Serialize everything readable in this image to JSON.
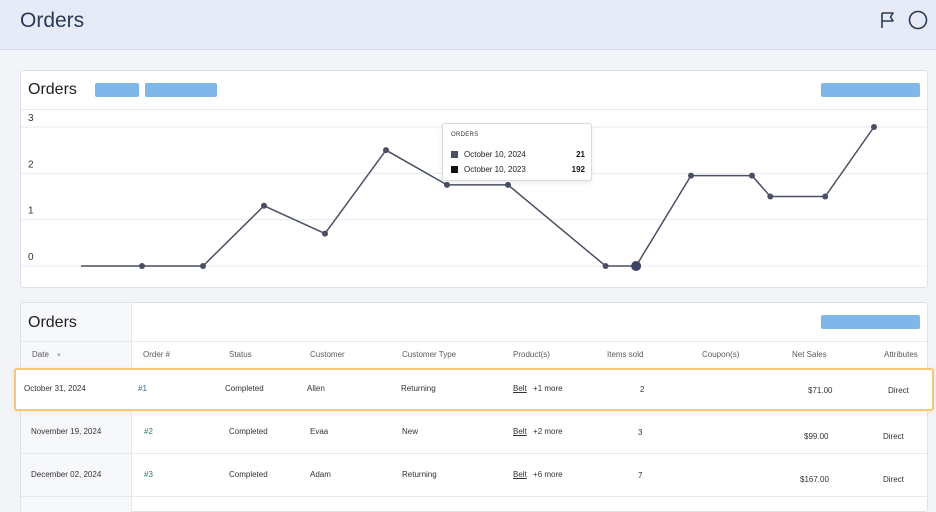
{
  "header": {
    "title": "Orders",
    "icons": [
      "flag-icon",
      "circle-icon"
    ]
  },
  "chart_panel": {
    "title": "Orders"
  },
  "chart_data": {
    "type": "line",
    "x": [
      0,
      1,
      2,
      3,
      4,
      5,
      6,
      7,
      8,
      9,
      10,
      11,
      12,
      13,
      14,
      15
    ],
    "series": [
      {
        "values": [
          0,
          0,
          1.3,
          0.7,
          2.5,
          1.75,
          1.75,
          0,
          0,
          1.95,
          1.95,
          1.5,
          1.5,
          3
        ]
      }
    ],
    "point_x": [
      1,
      2,
      3,
      4,
      5,
      6,
      7,
      8.6,
      9.1,
      10,
      11,
      11.3,
      12.2,
      13
    ],
    "yticks": [
      0,
      1,
      2,
      3
    ],
    "ylim": [
      0,
      3
    ],
    "grid": true,
    "colors": {
      "line": "#4a4f63",
      "highlight_point": "#3d4466"
    }
  },
  "tooltip": {
    "title": "ORDERS",
    "rows": [
      {
        "label": "October 10, 2024",
        "value": "21",
        "color": "#4a4f63"
      },
      {
        "label": "October 10, 2023",
        "value": "192",
        "color": "#111111"
      }
    ]
  },
  "table_panel": {
    "title": "Orders"
  },
  "table": {
    "columns": [
      "Date",
      "Order #",
      "Status",
      "Customer",
      "Customer Type",
      "Product(s)",
      "Items sold",
      "Coupon(s)",
      "Net Sales",
      "Attributes"
    ],
    "sort_icon": "chevron-down-icon",
    "rows": [
      {
        "date": "October 31, 2024",
        "order": "#1",
        "status": "Completed",
        "customer": "Allen",
        "customer_type": "Returning",
        "product": "Belt",
        "more": "+1 more",
        "items": "2",
        "coupon": "",
        "net": "$71.00",
        "attr": "Direct"
      },
      {
        "date": "November 19, 2024",
        "order": "#2",
        "status": "Completed",
        "customer": "Evaa",
        "customer_type": "New",
        "product": "Belt",
        "more": "+2 more",
        "items": "3",
        "coupon": "",
        "net": "$99.00",
        "attr": "Direct"
      },
      {
        "date": "December 02, 2024",
        "order": "#3",
        "status": "Completed",
        "customer": "Adam",
        "customer_type": "Returning",
        "product": "Belt",
        "more": "+6 more",
        "items": "7",
        "coupon": "",
        "net": "$167.00",
        "attr": "Direct"
      }
    ]
  }
}
